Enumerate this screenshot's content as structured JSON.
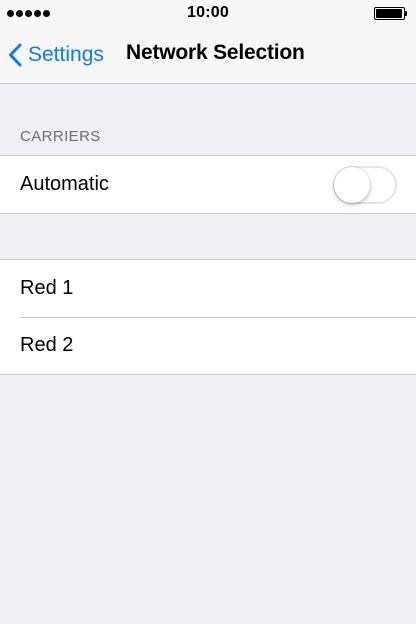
{
  "status_bar": {
    "time": "10:00",
    "signal_bars": 5,
    "battery_level": 1.0
  },
  "nav": {
    "back_label": "Settings",
    "title": "Network Selection"
  },
  "carriers_section": {
    "header": "CARRIERS",
    "automatic": {
      "label": "Automatic",
      "enabled": false
    }
  },
  "networks": [
    {
      "label": "Red 1"
    },
    {
      "label": "Red 2"
    }
  ],
  "colors": {
    "accent": "#0a7aff",
    "background": "#efeff4",
    "separator": "#c8c7cc",
    "section_header": "#6d6d72"
  }
}
